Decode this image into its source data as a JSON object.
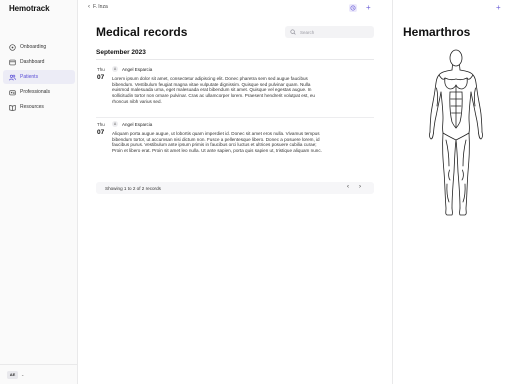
{
  "app": {
    "brand": "Hemotrack"
  },
  "sidebar": {
    "items": [
      {
        "label": "Onboarding",
        "icon": "onboarding-icon",
        "active": false
      },
      {
        "label": "Dashboard",
        "icon": "dashboard-icon",
        "active": false
      },
      {
        "label": "Patients",
        "icon": "users-icon",
        "active": true
      },
      {
        "label": "Professionals",
        "icon": "professionals-icon",
        "active": false
      },
      {
        "label": "Resources",
        "icon": "book-icon",
        "active": false
      }
    ],
    "user_initials": "AE",
    "user_chevron": "⌄"
  },
  "topbar": {
    "back_label": "F. Inza",
    "back_glyph": "‹",
    "add_glyph": "+"
  },
  "main": {
    "title": "Medical records",
    "search_placeholder": "Search",
    "section": "September 2023",
    "records": [
      {
        "day": "Thu",
        "date": "07",
        "author": "Angel Esparcia",
        "author_initial": "A",
        "text": "Lorem ipsum dolor sit amet, consectetur adipiscing elit. Donec pharetra sem sed augue faucibus bibendum. Vestibulum feugiat magna vitae vulputate dignissim. Quisque sed pulvinar quam. Nulla euismod malesuada urna, eget malesuada erat bibendum sit amet. Quisque vel egestas augue. In sollicitudin tortor non ornare pulvinar. Cras ac ullamcorper lorem. Praesent hendrerit volutpat est, eu rhoncus nibh varius sed."
      },
      {
        "day": "Thu",
        "date": "07",
        "author": "Angel Esparcia",
        "author_initial": "A",
        "text": "Aliquam porta augue augue, ut lobortis quam imperdiet id. Donec sit amet eros nulla. Vivamus tempus bibendum tortor, ut accumsan nisi dictum non. Fusce a pellentesque libero. Donec a posuere lorem, id faucibus purus. Vestibulum ante ipsum primis in faucibus orci luctus et ultrices posuere cubilia curae; Proin et libero erat. Proin sit amet leo nulla. Ut ante sapien, porta quis sapien ut, tristique aliquam nunc."
      }
    ],
    "pagination": {
      "summary": "Showing 1 to 2 of 2 records",
      "prev": "‹",
      "next": "›"
    }
  },
  "right_panel": {
    "title": "Hemarthros",
    "add_glyph": "+",
    "figure_icon": "body-anatomy-icon"
  },
  "colors": {
    "accent": "#5b4fd6",
    "active_bg": "#ececf6",
    "border": "#e9e9ea"
  }
}
